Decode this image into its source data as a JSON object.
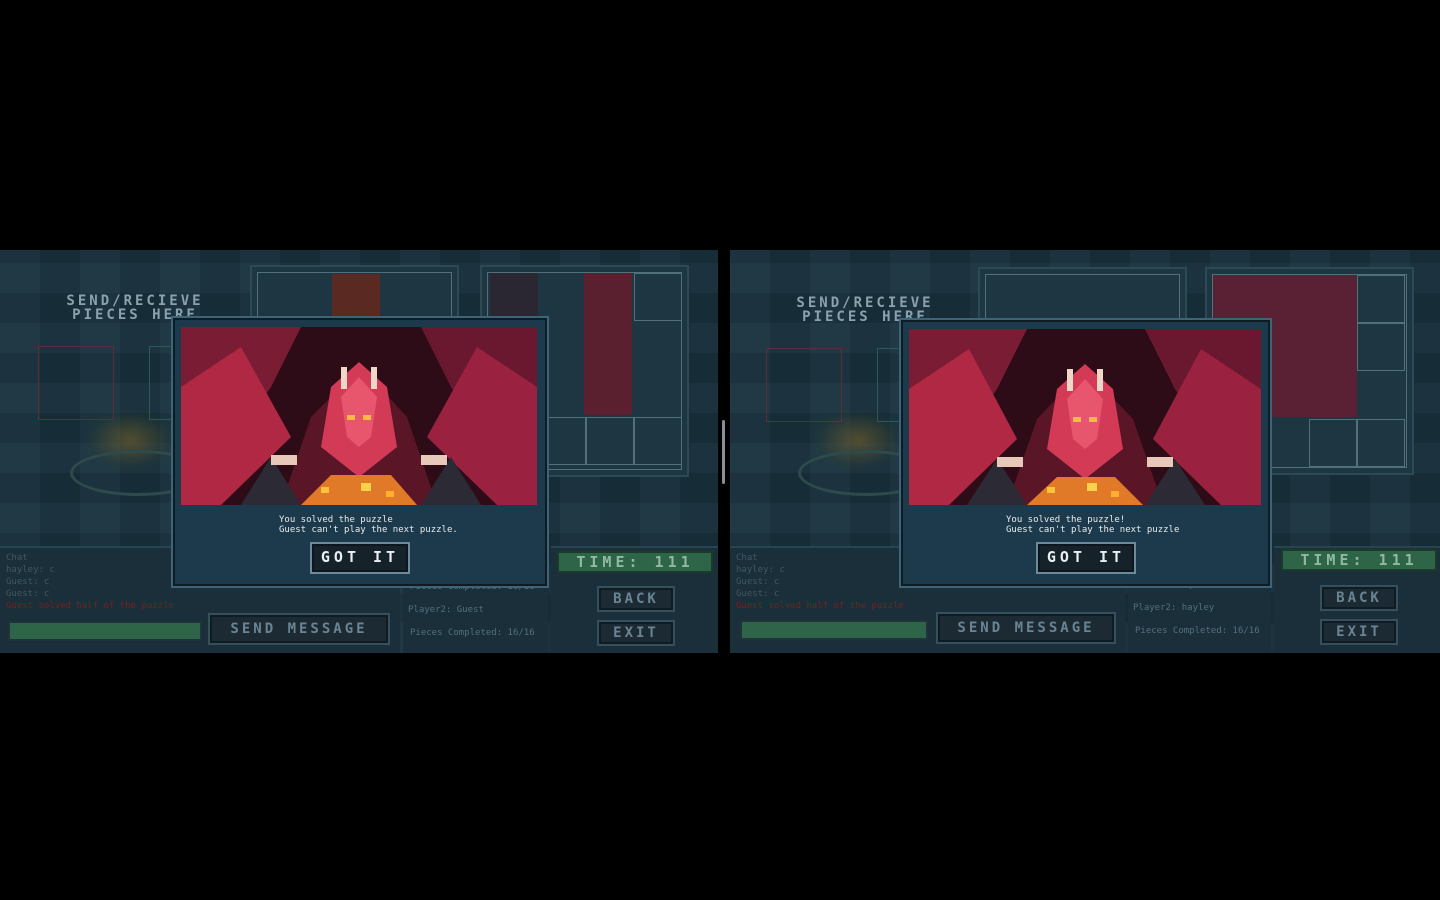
{
  "screens": [
    {
      "send_title": "SEND/RECIEVE\nPIECES HERE",
      "chat": [
        "Chat",
        "hayley: c",
        "Guest: c",
        "Guest: c"
      ],
      "chat_alert": "Guest solved half of the puzzle",
      "send_button": "SEND MESSAGE",
      "timer": "TIME: 111",
      "back_button": "BACK",
      "exit_button": "EXIT",
      "stats": [
        "Pieces Completed: 16/16",
        "Player2: Guest",
        "Pieces Completed: 16/16"
      ],
      "modal_line1": "You solved the puzzle",
      "modal_line2": "Guest can't play the next puzzle.",
      "got_it": "GOT IT"
    },
    {
      "send_title": "SEND/RECIEVE\nPIECES HERE",
      "chat": [
        "Chat",
        "hayley: c",
        "Guest: c",
        "Guest: c"
      ],
      "chat_alert": "Guest solved half of the puzzle",
      "send_button": "SEND MESSAGE",
      "timer": "TIME: 111",
      "back_button": "BACK",
      "exit_button": "EXIT",
      "stats": [
        "Pieces Completed: 16/16",
        "Player2: hayley",
        "Pieces Completed: 16/16"
      ],
      "modal_line1": "You solved the puzzle!",
      "modal_line2": "Guest can't play the next puzzle",
      "got_it": "GOT IT"
    }
  ],
  "colors": {
    "background": "#18313d",
    "modal": "#1d3a4c",
    "timer_green": "#2e6548",
    "alert_red": "#7a1f1f",
    "dragon_red": "#c8304a"
  },
  "icons": [
    "dragon-artwork",
    "fountain"
  ]
}
